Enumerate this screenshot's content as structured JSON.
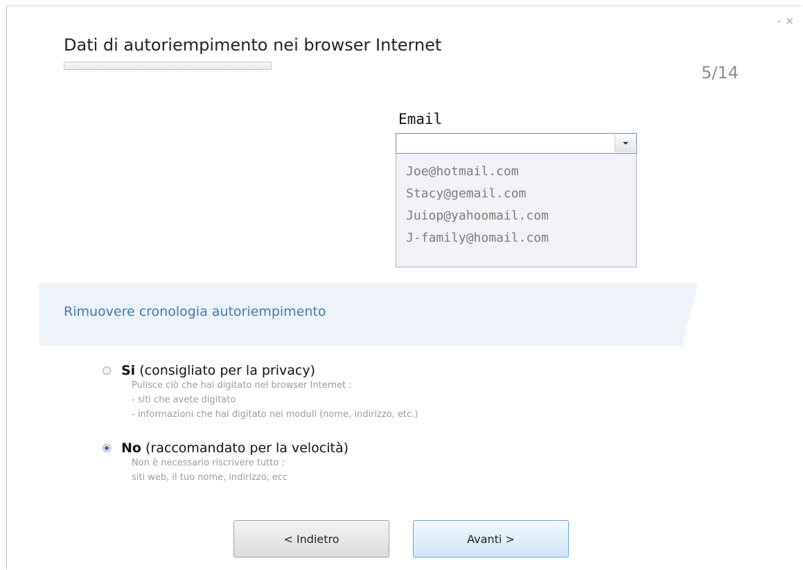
{
  "window": {
    "minimize_glyph": "-",
    "close_glyph": "×"
  },
  "header": {
    "title": "Dati di autoriempimento nei browser Internet",
    "step": "5/14",
    "progress_fraction": 0
  },
  "email": {
    "label": "Email",
    "selected_value": "",
    "options": [
      "Joe@hotmail.com",
      "Stacy@gemail.com",
      "Juiop@yahoomail.com",
      "J-family@homail.com"
    ]
  },
  "section": {
    "title": "Rimuovere cronologia autoriempimento"
  },
  "options": {
    "yes": {
      "label_bold": "Si",
      "label_rest": " (consigliato per la privacy)",
      "selected": false,
      "desc": [
        "Pulisce ciò che hai digitato nel browser Internet :",
        "- siti che avete digitato",
        "- informazioni che hai digitato nei moduli (nome, indirizzo, etc.)"
      ]
    },
    "no": {
      "label_bold": "No",
      "label_rest": " (raccomandato per la velocità)",
      "selected": true,
      "desc": [
        "Non è necessario riscrivere tutto :",
        "siti web, il tuo nome, indirizzo, ecc"
      ]
    }
  },
  "buttons": {
    "back": "< Indietro",
    "next": "Avanti >"
  }
}
